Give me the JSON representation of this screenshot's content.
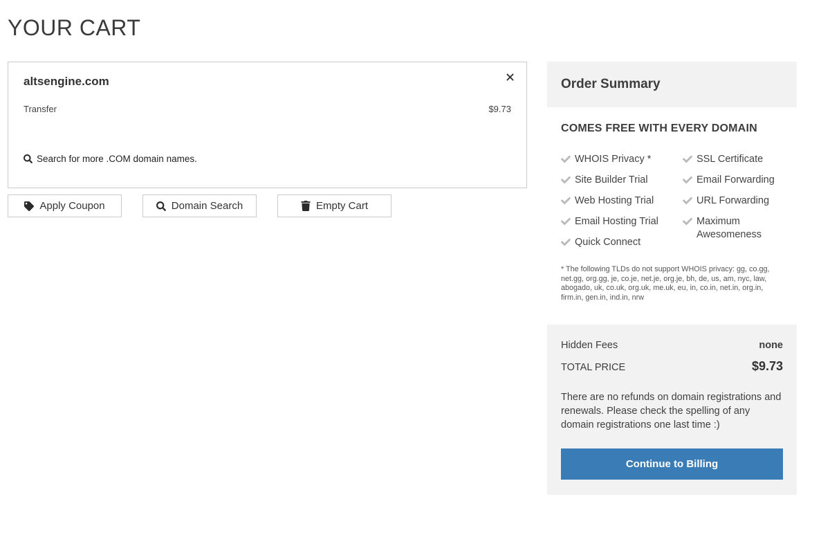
{
  "page": {
    "title": "YOUR CART"
  },
  "cart": {
    "item": {
      "domain": "altsengine.com",
      "type": "Transfer",
      "price": "$9.73"
    },
    "search_more": "Search for more .COM domain names.",
    "buttons": {
      "apply_coupon": "Apply Coupon",
      "domain_search": "Domain Search",
      "empty_cart": "Empty Cart"
    }
  },
  "order_summary": {
    "title": "Order Summary",
    "free_heading": "COMES FREE WITH EVERY DOMAIN",
    "free_items": [
      "WHOIS Privacy *",
      "Site Builder Trial",
      "Web Hosting Trial",
      "Email Hosting Trial",
      "Quick Connect",
      "SSL Certificate",
      "Email Forwarding",
      "URL Forwarding",
      "Maximum Awesomeness"
    ],
    "privacy_note": "* The following TLDs do not support WHOIS privacy: gg, co.gg, net.gg, org.gg, je, co.je, net.je, org.je, bh, de, us, am, nyc, law, abogado, uk, co.uk, org.uk, me.uk, eu, in, co.in, net.in, org.in, firm.in, gen.in, ind.in, nrw",
    "totals": {
      "hidden_fees_label": "Hidden Fees",
      "hidden_fees_value": "none",
      "total_label": "TOTAL PRICE",
      "total_value": "$9.73"
    },
    "refund_note": "There are no refunds on domain registrations and renewals. Please check the spelling of any domain registrations one last time :)",
    "continue_button": "Continue to Billing"
  },
  "colors": {
    "accent_blue": "#3a7cb5",
    "panel_gray": "#f2f2f2",
    "check_gray": "#b9b9b9"
  }
}
